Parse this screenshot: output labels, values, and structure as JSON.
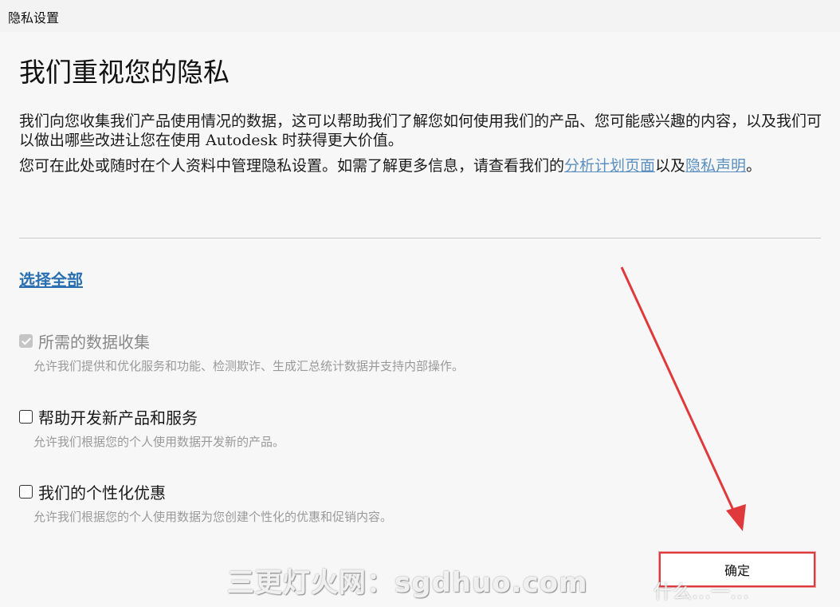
{
  "window": {
    "title": "隐私设置"
  },
  "main": {
    "heading": "我们重视您的隐私",
    "intro_p1": "我们向您收集我们产品使用情况的数据，这可以帮助我们了解您如何使用我们的产品、您可能感兴趣的内容，以及我们可以做出哪些改进让您在使用 Autodesk 时获得更大价值。",
    "intro_p2_before": "您可在此处或随时在个人资料中管理隐私设置。如需了解更多信息，请查看我们的",
    "intro_p2_link1": "分析计划页面",
    "intro_p2_middle": "以及",
    "intro_p2_link2": "隐私声明",
    "intro_p2_after": "。",
    "select_all": "选择全部"
  },
  "options": [
    {
      "label": "所需的数据收集",
      "description": "允许我们提供和优化服务和功能、检测欺诈、生成汇总统计数据并支持内部操作。",
      "checked": true,
      "disabled": true
    },
    {
      "label": "帮助开发新产品和服务",
      "description": "允许我们根据您的个人使用数据开发新的产品。",
      "checked": false,
      "disabled": false
    },
    {
      "label": "我们的个性化优惠",
      "description": "允许我们根据您的个人使用数据为您创建个性化的优惠和促销内容。",
      "checked": false,
      "disabled": false
    }
  ],
  "footer": {
    "ok_label": "确定"
  },
  "watermark": {
    "text": "三更灯火网：sgdhuo.com",
    "text2": "什么…一…"
  },
  "colors": {
    "link": "#5b8fc0",
    "select_all": "#2a6fb0",
    "highlight": "#e0393c"
  }
}
